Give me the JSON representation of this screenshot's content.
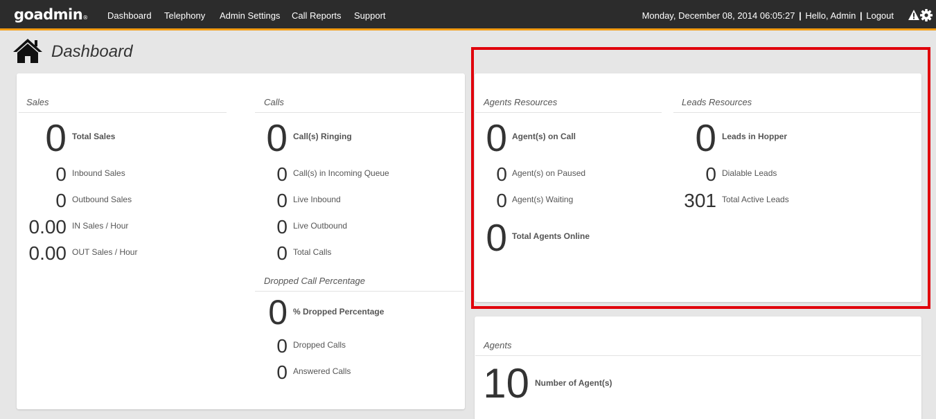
{
  "header": {
    "logo": "goadmin",
    "logo_mark": "®",
    "nav": [
      "Dashboard",
      "Telephony",
      "Admin Settings",
      "Call Reports",
      "Support"
    ],
    "datetime": "Monday, December 08, 2014 06:05:27",
    "greeting": "Hello, Admin",
    "logout": "Logout",
    "sep": "|"
  },
  "page": {
    "title": "Dashboard"
  },
  "sales": {
    "title": "Sales",
    "total_sales": {
      "value": "0",
      "label": "Total Sales"
    },
    "inbound_sales": {
      "value": "0",
      "label": "Inbound Sales"
    },
    "outbound_sales": {
      "value": "0",
      "label": "Outbound Sales"
    },
    "in_sales_hour": {
      "value": "0.00",
      "label": "IN Sales / Hour"
    },
    "out_sales_hour": {
      "value": "0.00",
      "label": "OUT Sales / Hour"
    }
  },
  "calls": {
    "title": "Calls",
    "ringing": {
      "value": "0",
      "label": "Call(s) Ringing"
    },
    "incoming_queue": {
      "value": "0",
      "label": "Call(s) in Incoming Queue"
    },
    "live_inbound": {
      "value": "0",
      "label": "Live Inbound"
    },
    "live_outbound": {
      "value": "0",
      "label": "Live Outbound"
    },
    "total_calls": {
      "value": "0",
      "label": "Total Calls"
    }
  },
  "dropped": {
    "title": "Dropped Call Percentage",
    "percentage": {
      "value": "0",
      "label": "% Dropped Percentage"
    },
    "dropped_calls": {
      "value": "0",
      "label": "Dropped Calls"
    },
    "answered_calls": {
      "value": "0",
      "label": "Answered Calls"
    }
  },
  "agents_resources": {
    "title": "Agents Resources",
    "on_call": {
      "value": "0",
      "label": "Agent(s) on Call"
    },
    "on_paused": {
      "value": "0",
      "label": "Agent(s) on Paused"
    },
    "waiting": {
      "value": "0",
      "label": "Agent(s) Waiting"
    },
    "total_online": {
      "value": "0",
      "label": "Total Agents Online"
    }
  },
  "leads_resources": {
    "title": "Leads Resources",
    "in_hopper": {
      "value": "0",
      "label": "Leads in Hopper"
    },
    "dialable": {
      "value": "0",
      "label": "Dialable Leads"
    },
    "total_active": {
      "value": "301",
      "label": "Total Active Leads"
    }
  },
  "agents": {
    "title": "Agents",
    "number": {
      "value": "10",
      "label": "Number of Agent(s)"
    }
  },
  "colors": {
    "topbar": "#2c2c2c",
    "accent": "#f39c12",
    "highlight": "#e0000b"
  },
  "icons": [
    "warning-icon",
    "gear-icon",
    "home-icon"
  ]
}
